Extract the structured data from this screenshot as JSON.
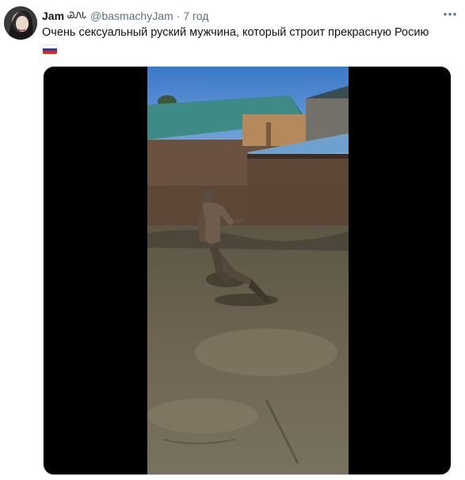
{
  "tweet": {
    "display_name": "Jam",
    "name_emoji": "ᏊᏁᏓ",
    "handle": "@basmachyJam",
    "separator": "·",
    "time": "7 год",
    "text": "Очень сексуальный руский мужчина, который строит прекрасную Росию",
    "flag": {
      "emoji": "🇷🇺",
      "colors": [
        "#ffffff",
        "#1c3fbf",
        "#d52b1e"
      ]
    }
  },
  "icons": {
    "more": "more-horizontal-icon",
    "avatar": "user-avatar"
  },
  "colors": {
    "text_primary": "#0f1419",
    "text_secondary": "#5b7083",
    "media_background": "#000000",
    "border": "#e1e8ed"
  }
}
